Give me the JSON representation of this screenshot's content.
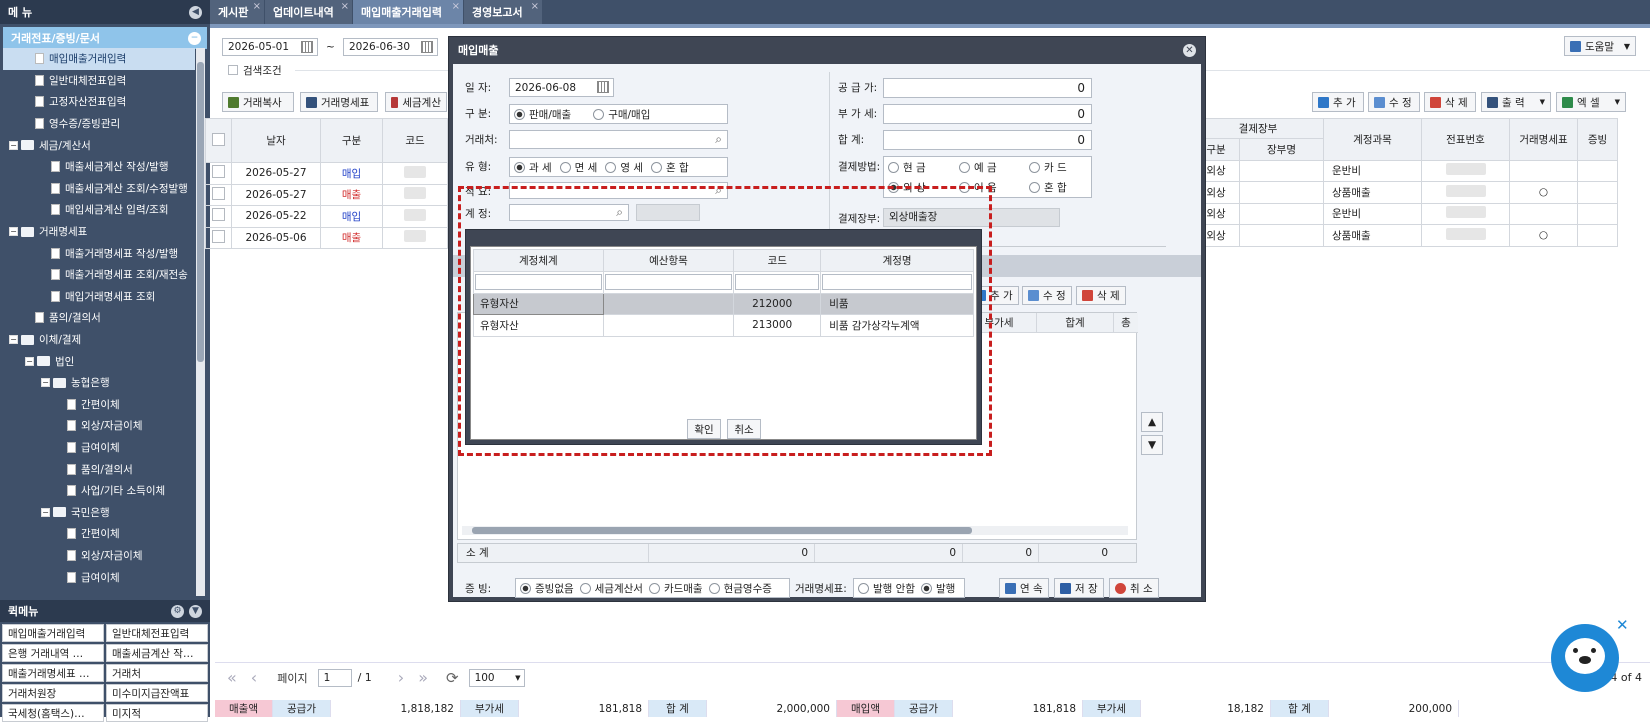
{
  "sidebar": {
    "title": "메 뉴",
    "section": "거래전표/증빙/문서",
    "items": [
      {
        "label": "매입매출거래입력",
        "level": 1,
        "type": "doc"
      },
      {
        "label": "일반대체전표입력",
        "level": 1,
        "type": "doc"
      },
      {
        "label": "고정자산전표입력",
        "level": 1,
        "type": "doc"
      },
      {
        "label": "영수증/증빙관리",
        "level": 1,
        "type": "doc"
      },
      {
        "label": "세금/계산서",
        "level": 0,
        "type": "folder"
      },
      {
        "label": "매출세금계산 작성/발행",
        "level": 2,
        "type": "doc"
      },
      {
        "label": "매출세금계산 조회/수정발행",
        "level": 2,
        "type": "doc"
      },
      {
        "label": "매입세금계산 입력/조회",
        "level": 2,
        "type": "doc"
      },
      {
        "label": "거래명세표",
        "level": 0,
        "type": "folder"
      },
      {
        "label": "매출거래명세표 작성/발행",
        "level": 2,
        "type": "doc"
      },
      {
        "label": "매출거래명세표 조회/재전송",
        "level": 2,
        "type": "doc"
      },
      {
        "label": "매입거래명세표 조회",
        "level": 2,
        "type": "doc"
      },
      {
        "label": "품의/결의서",
        "level": 1,
        "type": "doc"
      },
      {
        "label": "이체/결제",
        "level": 0,
        "type": "folder"
      },
      {
        "label": "법인",
        "level": 1,
        "type": "folder"
      },
      {
        "label": "농협은행",
        "level": 2,
        "type": "folder"
      },
      {
        "label": "간편이체",
        "level": 3,
        "type": "doc"
      },
      {
        "label": "외상/자금이체",
        "level": 3,
        "type": "doc"
      },
      {
        "label": "급여이체",
        "level": 3,
        "type": "doc"
      },
      {
        "label": "품의/결의서",
        "level": 3,
        "type": "doc"
      },
      {
        "label": "사업/기타 소득이체",
        "level": 3,
        "type": "doc"
      },
      {
        "label": "국민은행",
        "level": 2,
        "type": "folder"
      },
      {
        "label": "간편이체",
        "level": 3,
        "type": "doc"
      },
      {
        "label": "외상/자금이체",
        "level": 3,
        "type": "doc"
      },
      {
        "label": "급여이체",
        "level": 3,
        "type": "doc"
      }
    ]
  },
  "quick": {
    "title": "퀵메뉴",
    "items": [
      "매입매출거래입력",
      "일반대체전표입력",
      "은행 거래내역 …",
      "매출세금계산 작…",
      "매출거래명세표 …",
      "거래처",
      "거래처원장",
      "미수미지급잔액표",
      "국세청(홈택스)…",
      "미지적"
    ]
  },
  "tabs": [
    {
      "label": "게시판",
      "closable": true
    },
    {
      "label": "업데이트내역",
      "closable": true
    },
    {
      "label": "매입매출거래입력",
      "closable": true,
      "active": true
    },
    {
      "label": "경영보고서",
      "closable": true
    }
  ],
  "filter": {
    "date_from": "2026-05-01",
    "tilde": "~",
    "date_to": "2026-06-30",
    "search_cond": "검색조건",
    "help": "도움말"
  },
  "toolbar_left": [
    "거래복사",
    "거래명세표",
    "세금계산"
  ],
  "toolbar_right": {
    "add": "추 가",
    "edit": "수 정",
    "del": "삭 제",
    "print": "출 력",
    "excel": "엑 셀"
  },
  "grid": {
    "headers": [
      "날자",
      "구분",
      "코드"
    ],
    "right_headers": {
      "group": "결제장부",
      "sub1": "구분",
      "sub2": "장부명",
      "acct": "계정과목",
      "slip": "전표번호",
      "stmt": "거래명세표",
      "proof": "증빙"
    },
    "rows": [
      {
        "date": "2026-05-27",
        "type": "매입",
        "pay": "외상",
        "acct": "운반비",
        "stmt": ""
      },
      {
        "date": "2026-05-27",
        "type": "매출",
        "pay": "외상",
        "acct": "상품매출",
        "stmt": "○"
      },
      {
        "date": "2026-05-22",
        "type": "매입",
        "pay": "외상",
        "acct": "운반비",
        "stmt": ""
      },
      {
        "date": "2026-05-06",
        "type": "매출",
        "pay": "외상",
        "acct": "상품매출",
        "stmt": "○"
      }
    ]
  },
  "pager": {
    "page_label": "페이지",
    "page": "1",
    "total": "/ 1",
    "rows": "100",
    "count": "4 of 4"
  },
  "summary": [
    {
      "label": "매출액",
      "pink": true
    },
    {
      "label": "공급가",
      "blue": true
    },
    {
      "value": "1,818,182"
    },
    {
      "label": "부가세",
      "blue": true
    },
    {
      "value": "181,818"
    },
    {
      "label": "합 계",
      "blue": true
    },
    {
      "value": "2,000,000"
    },
    {
      "label": "매입액",
      "pink": true
    },
    {
      "label": "공급가",
      "blue": true
    },
    {
      "value": "181,818"
    },
    {
      "label": "부가세",
      "blue": true
    },
    {
      "value": "18,182"
    },
    {
      "label": "합 계",
      "blue": true
    },
    {
      "value": "200,000"
    }
  ],
  "dialog": {
    "title": "매입매출",
    "date_label": "일      자:",
    "date": "2026-06-08",
    "kind_label": "구      분:",
    "kind_opts": [
      "판매/매출",
      "구매/매입"
    ],
    "client_label": "거래처:",
    "vat_label": "유      형:",
    "vat_opts": [
      "과 세",
      "면 세",
      "영 세",
      "혼 합"
    ],
    "memo_label": "적      요:",
    "acct_label": "계      정:",
    "supply_label": "공 급 가:",
    "supply": "0",
    "vat_amt_label": "부 가 세:",
    "vat_amt": "0",
    "total_label": "합      계:",
    "total": "0",
    "pay_label": "결제방법:",
    "pay_opts": [
      "현 금",
      "예 금",
      "카 드",
      "외 상",
      "어 음",
      "혼 합"
    ],
    "book_label": "결제장부:",
    "book": "외상매출장",
    "item_btns": {
      "add": "추 가",
      "edit": "수 정",
      "del": "삭 제"
    },
    "item_headers": [
      "부가세",
      "합계",
      "총"
    ],
    "subtotal_label": "소 계",
    "subtotal_vals": [
      "0",
      "0",
      "0",
      "0"
    ],
    "proof_label": "증   빙:",
    "proof_opts": [
      "증빙없음",
      "세금계산서",
      "카드매출",
      "현금영수증"
    ],
    "stmt_label": "거래명세표:",
    "stmt_opts": [
      "발행 안함",
      "발행"
    ],
    "btn_cont": "연 속",
    "btn_save": "저 장",
    "btn_cancel": "취 소"
  },
  "popup": {
    "headers": [
      "계정체계",
      "예산항목",
      "코드",
      "계정명"
    ],
    "rows": [
      {
        "sys": "유형자산",
        "budget": "",
        "code": "212000",
        "name": "비품"
      },
      {
        "sys": "유형자산",
        "budget": "",
        "code": "213000",
        "name": "비품 감가상각누계액"
      }
    ],
    "ok": "확인",
    "cancel": "취소"
  },
  "colors": {
    "accent": "#3f5069",
    "highlight": "#c81e1e",
    "buy": "#1f3fc7",
    "sell": "#d12a2a"
  }
}
